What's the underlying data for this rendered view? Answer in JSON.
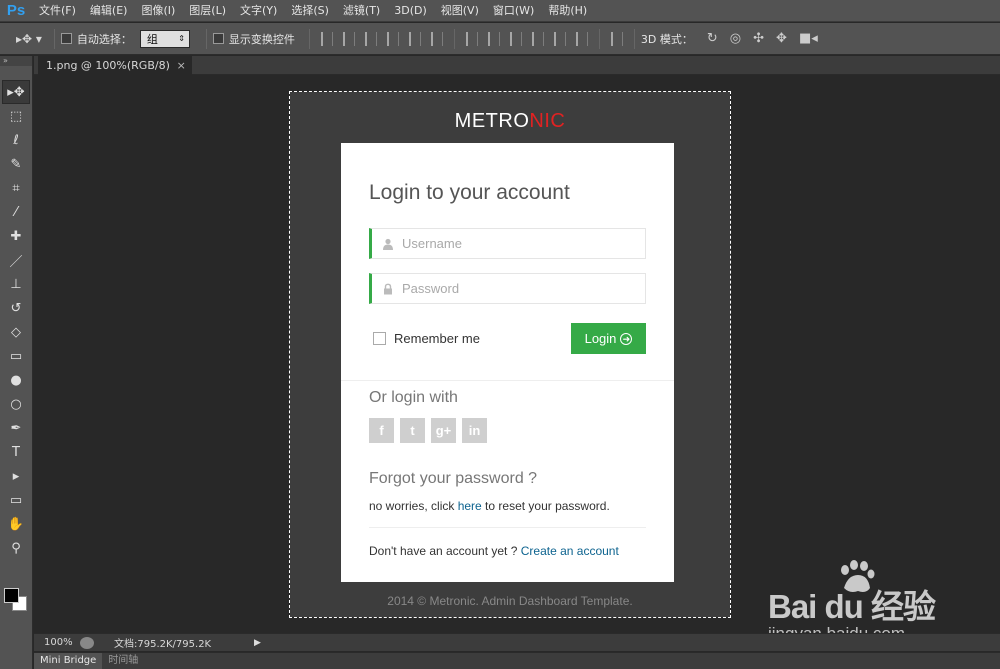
{
  "app": {
    "logo": "Ps"
  },
  "menu": [
    "文件(F)",
    "编辑(E)",
    "图像(I)",
    "图层(L)",
    "文字(Y)",
    "选择(S)",
    "滤镜(T)",
    "3D(D)",
    "视图(V)",
    "窗口(W)",
    "帮助(H)"
  ],
  "options_bar": {
    "auto_select_label": "自动选择：",
    "auto_select_value": "组",
    "show_transform_label": "显示变换控件",
    "mode_3d_label": "3D 模式："
  },
  "document_tab": {
    "title": "1.png @ 100%(RGB/8)",
    "close": "×"
  },
  "canvas": {
    "brand_part1": "METRO",
    "brand_part2": "NIC",
    "login": {
      "title": "Login to your account",
      "username_placeholder": "Username",
      "password_placeholder": "Password",
      "remember_label": "Remember me",
      "login_button": "Login",
      "or_login_with": "Or login with",
      "social": {
        "facebook": "f",
        "twitter": "t",
        "google": "g+",
        "linkedin": "in"
      },
      "forgot_title": "Forgot your password ?",
      "forgot_prefix": "no worries, click ",
      "forgot_link": "here",
      "forgot_suffix": " to reset your password.",
      "signup_prefix": "Don't have an account yet ? ",
      "signup_link": "Create an account"
    },
    "copyright": "2014 © Metronic. Admin Dashboard Template."
  },
  "status": {
    "zoom": "100%",
    "doc_size": "文档:795.2K/795.2K",
    "arrow": "▶"
  },
  "bottom_tabs": [
    "Mini Bridge",
    "时间轴"
  ],
  "watermark": {
    "text": "Bai  du 经验",
    "url": "jingyan.baidu.com"
  },
  "colors": {
    "accent_green": "#35aa47",
    "brand_red": "#e02222",
    "link_blue": "#0d638f",
    "ps_blue": "#32a0f0"
  }
}
